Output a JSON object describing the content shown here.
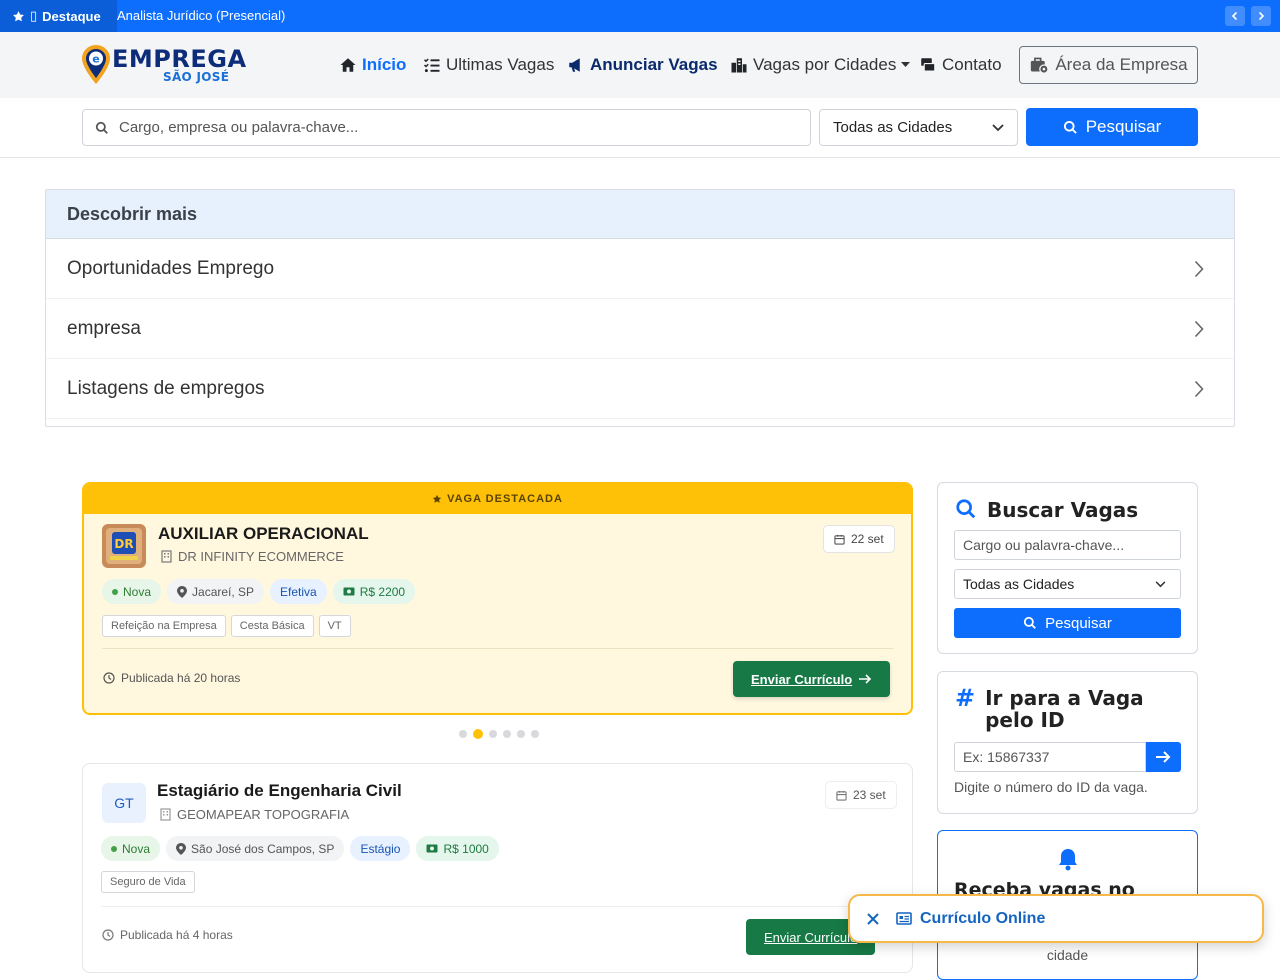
{
  "topbar": {
    "badge_label": "Destaque",
    "ticker_text": "Analista Jurídico (Presencial)"
  },
  "header": {
    "logo_line1": "EMPREGA",
    "logo_line2": "SÃO JOSÉ",
    "nav": {
      "inicio": "Início",
      "ultimas": "Ultimas Vagas",
      "anunciar": "Anunciar Vagas",
      "cidades": "Vagas por Cidades",
      "contato": "Contato",
      "area": "Área da Empresa"
    }
  },
  "search": {
    "placeholder": "Cargo, empresa ou palavra-chave...",
    "city_selected": "Todas as Cidades",
    "button": "Pesquisar"
  },
  "discover": {
    "title": "Descobrir mais",
    "items": [
      "Oportunidades Emprego",
      "empresa",
      "Listagens de empregos"
    ]
  },
  "featured": {
    "band": "VAGA DESTACADA",
    "title": "AUXILIAR OPERACIONAL",
    "company": "DR INFINITY ECOMMERCE",
    "date": "22 set",
    "tag_new": "Nova",
    "location": "Jacareí, SP",
    "type": "Efetiva",
    "salary": "R$ 2200",
    "benefits": [
      "Refeição na Empresa",
      "Cesta Básica",
      "VT"
    ],
    "published": "Publicada há 20 horas",
    "button": "Enviar Currículo"
  },
  "job2": {
    "logo_initials": "GT",
    "title": "Estagiário de Engenharia Civil",
    "company": "GEOMAPEAR TOPOGRAFIA",
    "date": "23 set",
    "tag_new": "Nova",
    "location": "São José dos Campos, SP",
    "type": "Estágio",
    "salary": "R$ 1000",
    "benefits": [
      "Seguro de Vida"
    ],
    "published": "Publicada há 4 horas",
    "button": "Enviar Currículo"
  },
  "sidebar": {
    "search_title": "Buscar Vagas",
    "search_placeholder": "Cargo ou palavra-chave...",
    "city_selected": "Todas as Cidades",
    "search_button": "Pesquisar",
    "id_title": "Ir para a Vaga pelo ID",
    "id_placeholder": "Ex: 15867337",
    "id_help": "Digite o número do ID da vaga.",
    "alert_title": "Receba vagas no celular",
    "alert_text": "cidade"
  },
  "floating": {
    "label": "Currículo Online"
  },
  "colors": {
    "primary": "#0d6efd",
    "featured_accent": "#ffc107",
    "send_button": "#177a46",
    "navy": "#0d2c7a"
  }
}
